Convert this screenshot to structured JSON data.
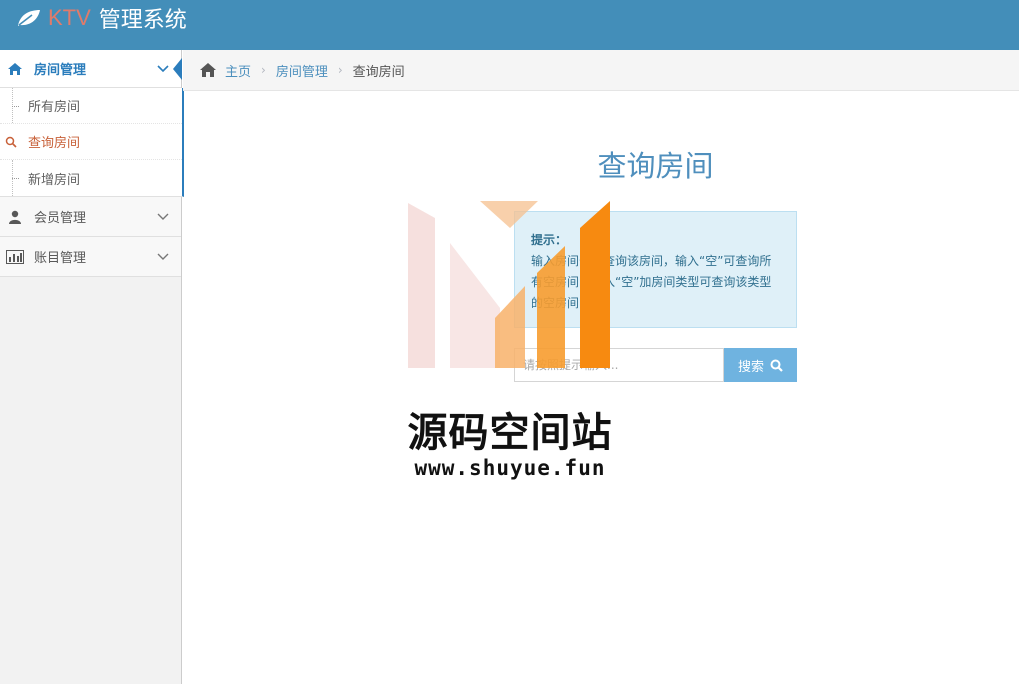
{
  "brand": {
    "ktv": "KTV",
    "title": "管理系统"
  },
  "sidebar": {
    "items": [
      {
        "label": "房间管理",
        "icon": "home-icon",
        "active": true,
        "children": [
          {
            "label": "所有房间"
          },
          {
            "label": "查询房间",
            "current": true
          },
          {
            "label": "新增房间"
          }
        ]
      },
      {
        "label": "会员管理",
        "icon": "user-icon"
      },
      {
        "label": "账目管理",
        "icon": "bar-chart-icon"
      }
    ]
  },
  "breadcrumb": {
    "home": "主页",
    "section": "房间管理",
    "current": "查询房间"
  },
  "main": {
    "title": "查询房间",
    "alert": {
      "heading": "提示：",
      "body": "输入房间号可查询该房间，输入“空”可查询所有空房间，输入“空”加房间类型可查询该类型的空房间"
    },
    "search": {
      "placeholder": "请按照提示输入...",
      "button_label": "搜索"
    }
  },
  "watermark": {
    "name": "源码空间站",
    "url": "www.shuyue.fun"
  },
  "colors": {
    "navbar": "#438eb9",
    "accent": "#2b7dbc",
    "alert_bg": "#dff0f8",
    "button": "#6fb3e0",
    "current_sub": "#c86139"
  }
}
